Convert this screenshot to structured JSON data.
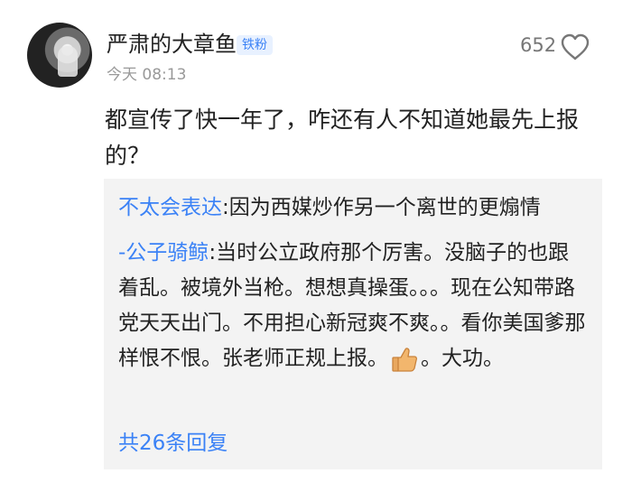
{
  "comment": {
    "username": "严肃的大章鱼",
    "badge": "铁粉",
    "time": "今天 08:13",
    "like_count": "652",
    "text": "都宣传了快一年了，咋还有人不知道她最先上报的？"
  },
  "replies": [
    {
      "author": "不太会表达",
      "text": "因为西媒炒作另一个离世的更煽情"
    },
    {
      "author": "-公子骑鲸",
      "text_before_emoji": "当时公立政府那个厉害。没脑子的也跟着乱。被境外当枪。想想真操蛋。。。现在公知带路党天天出门。不用担心新冠爽不爽。。看你美国爹那样恨不恨。张老师正规上报。",
      "emoji": "thumbs-up-icon",
      "text_after_emoji": "。大功。"
    }
  ],
  "more_replies": "共26条回复",
  "colors": {
    "link": "#3b82f6",
    "reply_bg": "#f3f3f3",
    "secondary_text": "#999999"
  }
}
